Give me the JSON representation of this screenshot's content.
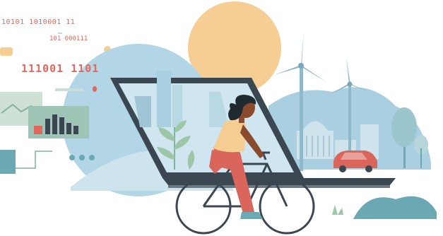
{
  "illustration": {
    "binary_lines": [
      "10101 1010001 11",
      "101 000111",
      "111001 1101"
    ],
    "colors": {
      "sun": "#f6cd92",
      "sky_circle": "#b3d6e6",
      "laptop": "#3b4750",
      "screen": "#cfe6f0",
      "accent_red": "#e0685f",
      "teal": "#6aa8b4",
      "skin": "#8a4a2e",
      "hair": "#1f2a30",
      "shirt": "#f6cd92",
      "pants": "#d9655b",
      "car": "#d9655b",
      "bush": "#6aa8b4"
    }
  }
}
